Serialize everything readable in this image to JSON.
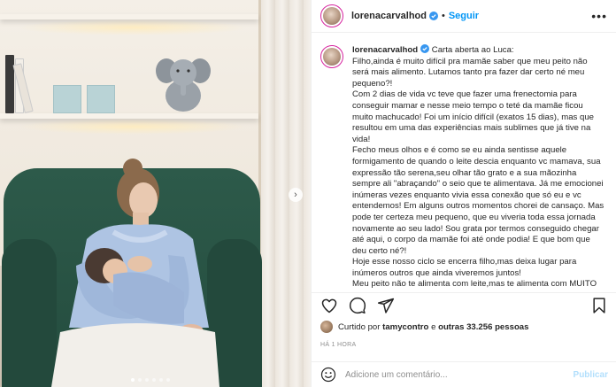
{
  "post": {
    "username": "lorenacarvalhod",
    "follow_label": "Seguir",
    "separator": "•",
    "more_label": "•••",
    "carousel": {
      "slides": 6,
      "active_index": 0
    }
  },
  "caption": {
    "username": "lorenacarvalhod",
    "title": "Carta aberta ao Luca:",
    "paragraphs": [
      "Filho,ainda é muito difícil pra mamãe saber que meu peito não será mais alimento. Lutamos tanto pra fazer dar certo né meu pequeno?!",
      "Com 2 dias de vida vc teve que fazer uma frenectomia para conseguir mamar e nesse meio tempo o teté da mamãe ficou muito machucado! Foi um início difícil (exatos 15 dias), mas que resultou em uma das experiências mais sublimes que já tive na vida!",
      "Fecho meus olhos e é como se eu ainda sentisse aquele formigamento de quando o leite descia enquanto vc mamava, sua expressão tão serena,seu olhar tão grato e a sua mãozinha sempre ali \"abraçando\" o seio que te alimentava. Já me emocionei inúmeras vezes enquanto vivia essa conexão que só eu e vc entendemos! Em alguns outros momentos chorei de cansaço. Mas pode ter certeza meu pequeno, que eu viveria toda essa jornada novamente ao seu lado! Sou grata por termos conseguido chegar até aqui, o corpo da mamãe foi até onde podia! E que bom que deu certo né?!",
      "Hoje esse nosso ciclo se encerra filho,mas deixa lugar para inúmeros outros que ainda viveremos juntos!",
      "Meu peito não te alimenta com leite,mas te alimenta com MUITO amor e acolhimento!"
    ]
  },
  "actions": {
    "like_icon": "heart-icon",
    "comment_icon": "comment-icon",
    "share_icon": "share-icon",
    "save_icon": "bookmark-icon"
  },
  "likes": {
    "prefix": "Curtido por",
    "user": "tamycontro",
    "connector": "e",
    "others": "outras 33.256 pessoas"
  },
  "timestamp": "HÁ 1 HORA",
  "comment_box": {
    "placeholder": "Adicione um comentário...",
    "publish_label": "Publicar"
  },
  "colors": {
    "accent": "#0095f6",
    "publish_disabled": "#b2dffc",
    "muted": "#8e8e8e",
    "story_ring": "#d6249f"
  }
}
